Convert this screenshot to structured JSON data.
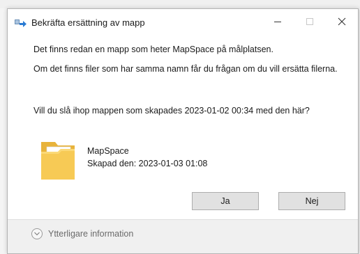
{
  "window": {
    "title": "Bekräfta ersättning av mapp",
    "minimize_symbol": "—",
    "maximize_symbol": "☐",
    "close_symbol": "✕",
    "app_icon": "move-folder-icon"
  },
  "message": {
    "line1": "Det finns redan en mapp som heter MapSpace på målplatsen.",
    "line2": "Om det finns filer som har samma namn får du frågan om du vill ersätta filerna.",
    "line3": "Vill du slå ihop mappen som skapades 2023-01-02 00:34 med den här?"
  },
  "folder": {
    "icon": "folder-icon",
    "name": "MapSpace",
    "created": "Skapad den: 2023-01-03 01:08"
  },
  "buttons": {
    "yes": "Ja",
    "no": "Nej"
  },
  "footer": {
    "more_info": "Ytterligare information",
    "icon": "chevron-down-icon"
  },
  "colors": {
    "button_bg": "#e1e1e1",
    "footer_bg": "#f0f0f0",
    "folder_yellow": "#f5c451"
  }
}
